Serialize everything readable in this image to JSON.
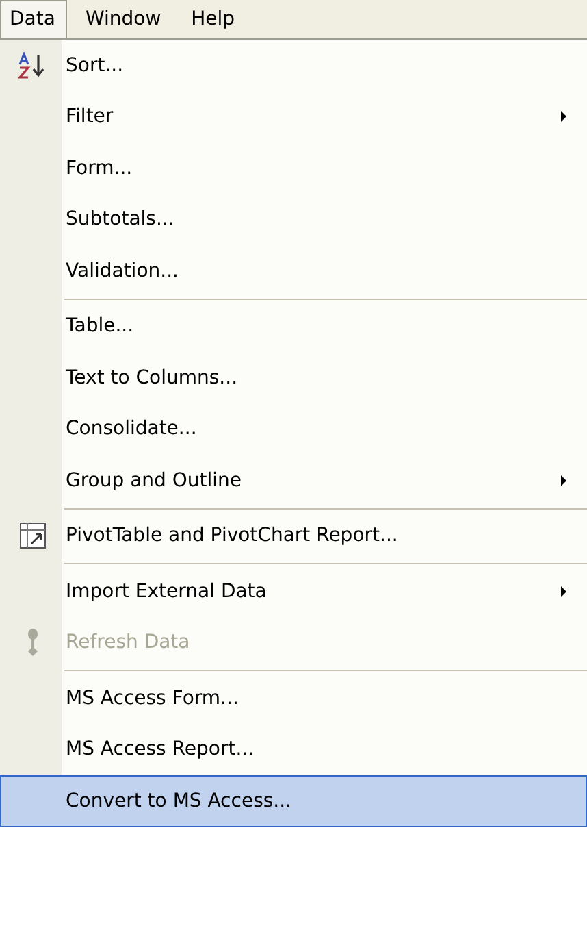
{
  "menu_bar": [
    {
      "label": "Data",
      "selected": true
    },
    {
      "label": "Window",
      "selected": false
    },
    {
      "label": "Help",
      "selected": false
    }
  ],
  "menu": [
    {
      "kind": "item",
      "label": "Sort...",
      "icon": true,
      "submenu": false,
      "disabled": false,
      "selected": false
    },
    {
      "kind": "item",
      "label": "Filter",
      "icon": false,
      "submenu": true,
      "disabled": false,
      "selected": false
    },
    {
      "kind": "item",
      "label": "Form...",
      "icon": false,
      "submenu": false,
      "disabled": false,
      "selected": false
    },
    {
      "kind": "item",
      "label": "Subtotals...",
      "icon": false,
      "submenu": false,
      "disabled": false,
      "selected": false
    },
    {
      "kind": "item",
      "label": "Validation...",
      "icon": false,
      "submenu": false,
      "disabled": false,
      "selected": false
    },
    {
      "kind": "separator"
    },
    {
      "kind": "item",
      "label": "Table...",
      "icon": false,
      "submenu": false,
      "disabled": false,
      "selected": false
    },
    {
      "kind": "item",
      "label": "Text to Columns...",
      "icon": false,
      "submenu": false,
      "disabled": false,
      "selected": false
    },
    {
      "kind": "item",
      "label": "Consolidate...",
      "icon": false,
      "submenu": false,
      "disabled": false,
      "selected": false
    },
    {
      "kind": "item",
      "label": "Group and Outline",
      "icon": false,
      "submenu": true,
      "disabled": false,
      "selected": false
    },
    {
      "kind": "separator"
    },
    {
      "kind": "item",
      "label": "PivotTable and PivotChart Report...",
      "icon": true,
      "submenu": false,
      "disabled": false,
      "selected": false
    },
    {
      "kind": "separator"
    },
    {
      "kind": "item",
      "label": "Import External Data",
      "icon": false,
      "submenu": true,
      "disabled": false,
      "selected": false
    },
    {
      "kind": "item",
      "label": "Refresh Data",
      "icon": true,
      "submenu": false,
      "disabled": true,
      "selected": false
    },
    {
      "kind": "separator"
    },
    {
      "kind": "item",
      "label": "MS Access Form...",
      "icon": false,
      "submenu": false,
      "disabled": false,
      "selected": false
    },
    {
      "kind": "item",
      "label": "MS Access Report...",
      "icon": false,
      "submenu": false,
      "disabled": false,
      "selected": false
    },
    {
      "kind": "item",
      "label": "Convert to MS Access...",
      "icon": false,
      "submenu": false,
      "disabled": false,
      "selected": true
    }
  ]
}
